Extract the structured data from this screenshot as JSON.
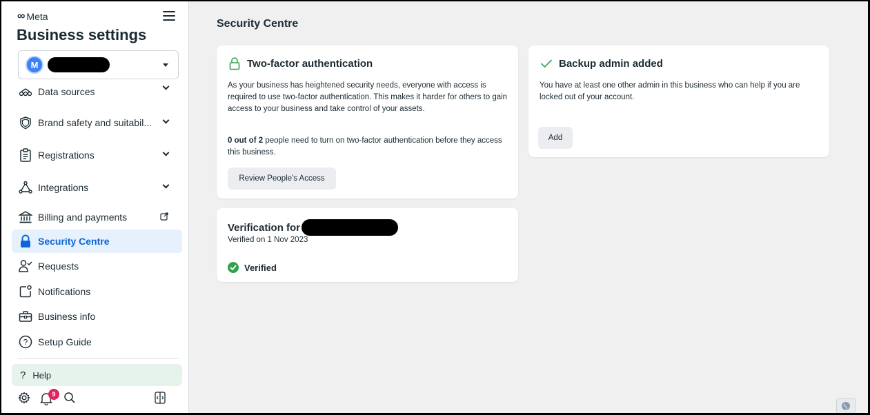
{
  "brand": {
    "logo_text": "Meta"
  },
  "sidebar": {
    "title": "Business settings",
    "account": {
      "avatar_letter": "M"
    },
    "items": [
      {
        "label": "Data sources",
        "icon": "data-sources-icon",
        "trailing": "chevron"
      },
      {
        "label": "Brand safety and suitabil...",
        "icon": "shield-icon",
        "trailing": "chevron"
      },
      {
        "label": "Registrations",
        "icon": "clipboard-icon",
        "trailing": "chevron"
      },
      {
        "label": "Integrations",
        "icon": "integrations-icon",
        "trailing": "chevron"
      },
      {
        "label": "Billing and payments",
        "icon": "bank-icon",
        "trailing": "external-link"
      },
      {
        "label": "Security Centre",
        "icon": "lock-icon",
        "active": true
      },
      {
        "label": "Requests",
        "icon": "person-check-icon"
      },
      {
        "label": "Notifications",
        "icon": "notification-icon"
      },
      {
        "label": "Business info",
        "icon": "briefcase-icon"
      },
      {
        "label": "Setup Guide",
        "icon": "question-circle-icon"
      }
    ],
    "help": {
      "label": "Help"
    },
    "notifications_badge": "9"
  },
  "main": {
    "title": "Security Centre",
    "two_factor": {
      "title": "Two-factor authentication",
      "description": "As your business has heightened security needs, everyone with access is required to use two-factor authentication. This makes it harder for others to gain access to your business and take control of your assets.",
      "count_bold": "0 out of 2",
      "count_rest": " people need to turn on two-factor authentication before they access this business.",
      "button": "Review People's Access"
    },
    "backup_admin": {
      "title": "Backup admin added",
      "description": "You have at least one other admin in this business who can help if you are locked out of your account.",
      "button": "Add"
    },
    "verification": {
      "title_prefix": "Verification for",
      "date": "Verified on 1 Nov 2023",
      "status": "Verified"
    }
  },
  "colors": {
    "accent": "#0a66d9",
    "active_bg": "#e7f0fd",
    "success": "#31a24c",
    "badge": "#e0245e",
    "help_bg": "#e6f2ec"
  }
}
